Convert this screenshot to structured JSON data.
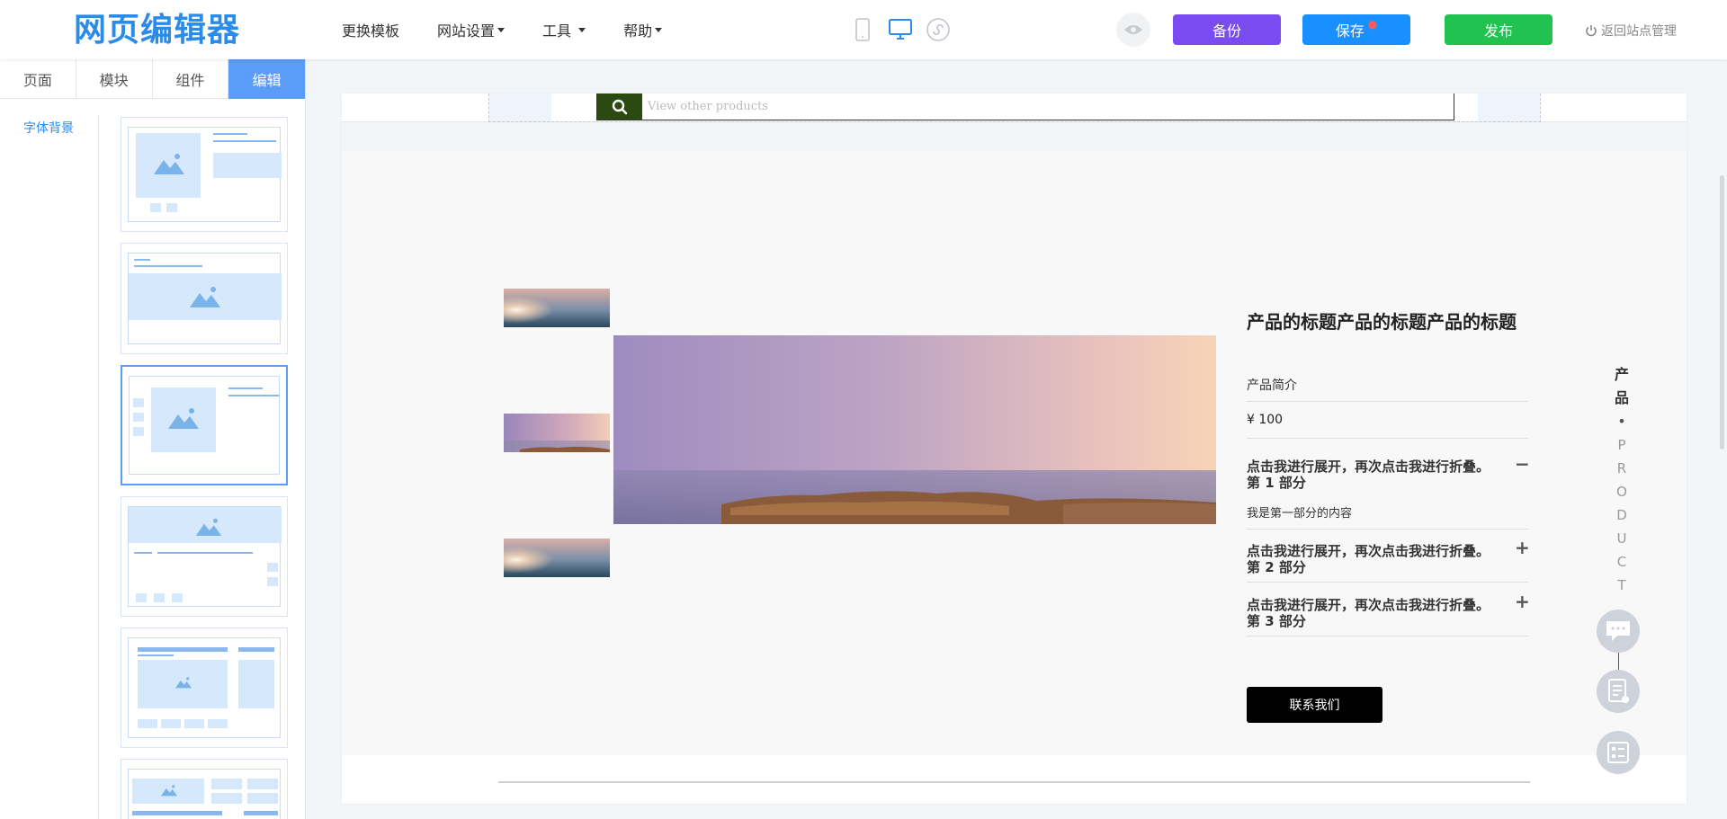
{
  "header": {
    "logo": "网页编辑器",
    "menu": [
      {
        "label": "更换模板",
        "dropdown": false
      },
      {
        "label": "网站设置",
        "dropdown": true
      },
      {
        "label": "工具",
        "dropdown": true
      },
      {
        "label": "帮助",
        "dropdown": true
      }
    ],
    "buttons": {
      "backup": "备份",
      "save": "保存",
      "save_dot": "●",
      "publish": "发布"
    },
    "back_link": "返回站点管理",
    "colors": {
      "backup": "#7a4cf0",
      "save": "#1890ff",
      "publish": "#21c24f",
      "brand": "#2b8be8"
    }
  },
  "sidebar": {
    "tabs": [
      {
        "label": "页面",
        "active": false
      },
      {
        "label": "模块",
        "active": false
      },
      {
        "label": "组件",
        "active": false
      },
      {
        "label": "编辑",
        "active": true
      }
    ],
    "category": "字体背景"
  },
  "canvas": {
    "search_placeholder": "View other products",
    "product": {
      "title": "产品的标题产品的标题产品的标题",
      "intro": "产品简介",
      "price": "¥ 100",
      "accordion": [
        {
          "title": "点击我进行展开，再次点击我进行折叠。第 1 部分",
          "sign": "−",
          "expanded": true,
          "body": "我是第一部分的内容"
        },
        {
          "title": "点击我进行展开，再次点击我进行折叠。第 2 部分",
          "sign": "+",
          "expanded": false
        },
        {
          "title": "点击我进行展开，再次点击我进行折叠。第 3 部分",
          "sign": "+",
          "expanded": false
        }
      ],
      "contact_button": "联系我们"
    }
  },
  "floating": {
    "vertical_cn": [
      "产",
      "品"
    ],
    "vertical_dot": "•",
    "vertical_en": [
      "P",
      "R",
      "O",
      "D",
      "U",
      "C",
      "T"
    ]
  }
}
